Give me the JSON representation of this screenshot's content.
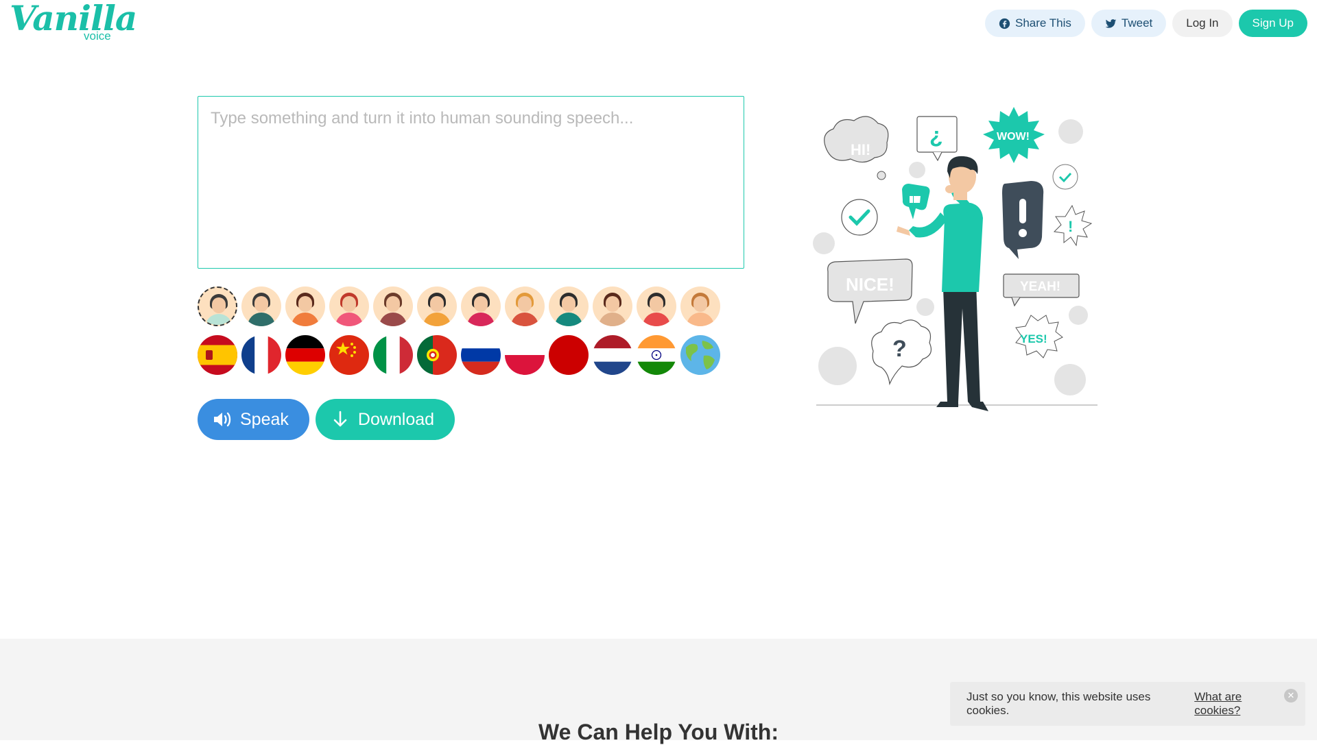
{
  "header": {
    "logo_script": "Vanilla",
    "logo_sub": "voice",
    "share_label": "Share This",
    "tweet_label": "Tweet",
    "login_label": "Log In",
    "signup_label": "Sign Up"
  },
  "editor": {
    "placeholder": "Type something and turn it into human sounding speech...",
    "value": ""
  },
  "voices": [
    {
      "name": "voice-1",
      "hair": "#3b3b3b",
      "body": "#b9e3d6",
      "selected": true
    },
    {
      "name": "voice-2",
      "hair": "#3b3b3b",
      "body": "#2f6e6a"
    },
    {
      "name": "voice-3",
      "hair": "#5a2a1c",
      "body": "#f07c3c"
    },
    {
      "name": "voice-4",
      "hair": "#c0392b",
      "body": "#f0577a"
    },
    {
      "name": "voice-5",
      "hair": "#6b3b2a",
      "body": "#9a4a4a"
    },
    {
      "name": "voice-6",
      "hair": "#2d2d2d",
      "body": "#f2a23a"
    },
    {
      "name": "voice-7",
      "hair": "#2d2d2d",
      "body": "#d8285a"
    },
    {
      "name": "voice-8",
      "hair": "#e39a3a",
      "body": "#d9533e"
    },
    {
      "name": "voice-9",
      "hair": "#2d2d2d",
      "body": "#15897e"
    },
    {
      "name": "voice-10",
      "hair": "#5a2a1c",
      "body": "#e0b08a"
    },
    {
      "name": "voice-11",
      "hair": "#2d2d2d",
      "body": "#e84b4b"
    },
    {
      "name": "voice-12",
      "hair": "#c47a3a",
      "body": "#f9b98a"
    }
  ],
  "flags": [
    "spain",
    "france",
    "germany",
    "china",
    "italy",
    "portugal",
    "russia",
    "poland",
    "japan",
    "netherlands",
    "india",
    "world"
  ],
  "actions": {
    "speak_label": "Speak",
    "download_label": "Download"
  },
  "illustration": {
    "hi": "HI!",
    "wow": "WOW!",
    "nice": "NICE!",
    "yeah": "YEAH!",
    "yes": "YES!",
    "question": "?",
    "inverted_question": "¿",
    "exclaim": "!"
  },
  "section": {
    "title": "We Can Help You With:"
  },
  "cookie": {
    "text": "Just so you know, this website uses cookies.",
    "link": "What are cookies?"
  },
  "colors": {
    "accent": "#1cc8ac",
    "speak": "#3a8ee0"
  }
}
